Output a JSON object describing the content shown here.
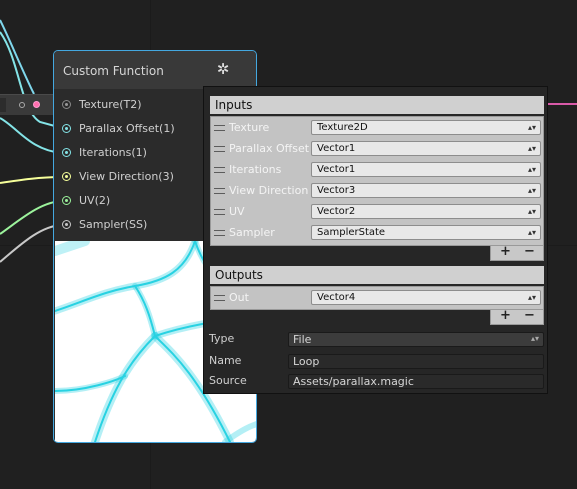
{
  "node": {
    "title": "Custom Function",
    "ports": [
      "Texture(T2)",
      "Parallax Offset(1)",
      "Iterations(1)",
      "View Direction(3)",
      "UV(2)",
      "Sampler(SS)"
    ]
  },
  "inspector": {
    "inputs_header": "Inputs",
    "inputs": [
      {
        "name": "Texture",
        "type": "Texture2D"
      },
      {
        "name": "Parallax Offset",
        "type": "Vector1"
      },
      {
        "name": "Iterations",
        "type": "Vector1"
      },
      {
        "name": "View Direction",
        "type": "Vector3"
      },
      {
        "name": "UV",
        "type": "Vector2"
      },
      {
        "name": "Sampler",
        "type": "SamplerState"
      }
    ],
    "outputs_header": "Outputs",
    "outputs": [
      {
        "name": "Out",
        "type": "Vector4"
      }
    ],
    "add_label": "+",
    "remove_label": "−",
    "type_label": "Type",
    "type_value": "File",
    "name_label": "Name",
    "name_value": "Loop",
    "source_label": "Source",
    "source_value": "Assets/parallax.magic"
  },
  "colors": {
    "node_border": "#44a8e0",
    "wire_texture": "#7fd7ec",
    "wire_vector1": "#84e4e7",
    "wire_vector3": "#f6ff9a",
    "wire_vector2": "#9cf39c",
    "wire_sampler": "#c8c8c8",
    "wire_output": "#d95aa8"
  }
}
